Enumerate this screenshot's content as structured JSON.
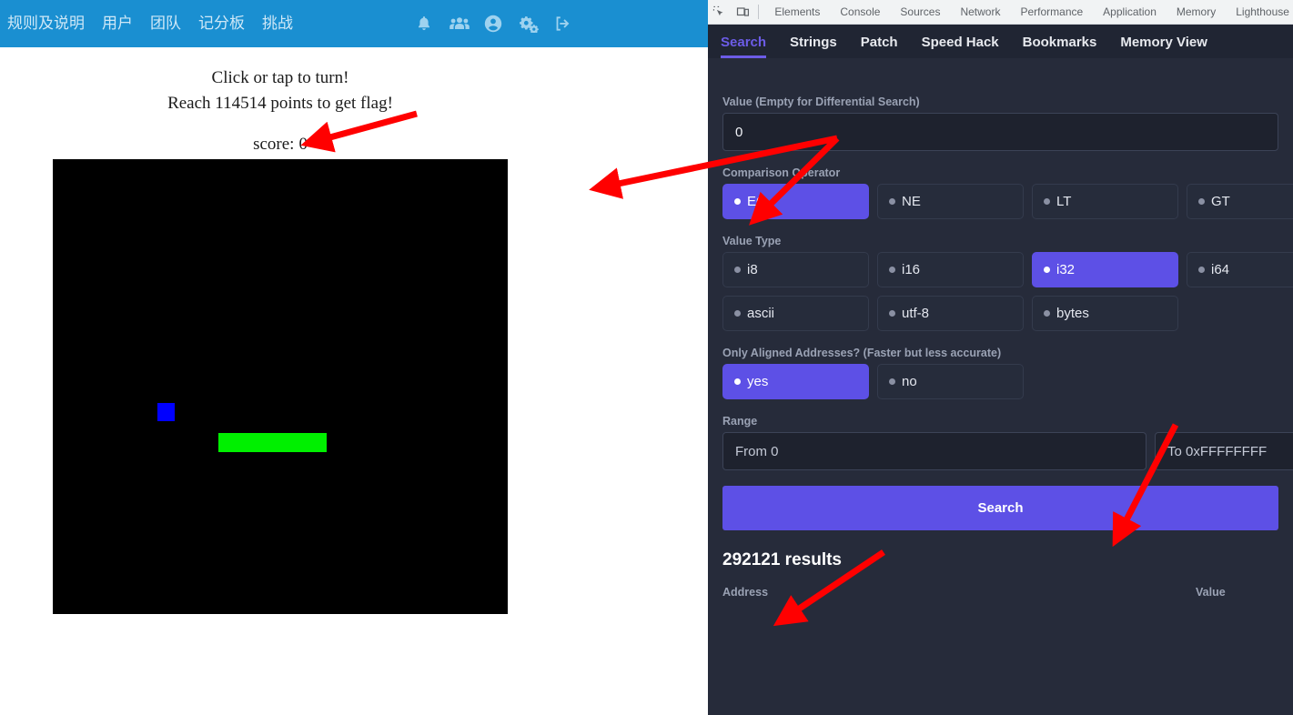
{
  "site": {
    "nav_links": [
      {
        "label": "规则及说明"
      },
      {
        "label": "用户"
      },
      {
        "label": "团队"
      },
      {
        "label": "记分板"
      },
      {
        "label": "挑战"
      }
    ],
    "nav_icons": [
      {
        "name": "bell-icon"
      },
      {
        "name": "users-icon"
      },
      {
        "name": "user-circle-icon"
      },
      {
        "name": "cogs-icon"
      },
      {
        "name": "sign-out-icon"
      }
    ],
    "navbar_color": "#1a8fd1"
  },
  "game": {
    "instruction": "Click or tap to turn!",
    "goal": "Reach 114514 points to get flag!",
    "score_label": "score:",
    "score_value": "0",
    "canvas_background": "#000000",
    "player_color": "#0000ff",
    "platform_color": "#00f000"
  },
  "devtools": {
    "toolbar_icons": [
      {
        "name": "inspect-element-icon"
      },
      {
        "name": "device-toolbar-icon"
      }
    ],
    "tabs": [
      {
        "label": "Elements"
      },
      {
        "label": "Console"
      },
      {
        "label": "Sources"
      },
      {
        "label": "Network"
      },
      {
        "label": "Performance"
      },
      {
        "label": "Application"
      },
      {
        "label": "Memory"
      },
      {
        "label": "Lighthouse"
      }
    ],
    "panel_tabs": [
      {
        "label": "Search",
        "active": true
      },
      {
        "label": "Strings",
        "active": false
      },
      {
        "label": "Patch",
        "active": false
      },
      {
        "label": "Speed Hack",
        "active": false
      },
      {
        "label": "Bookmarks",
        "active": false
      },
      {
        "label": "Memory View",
        "active": false
      }
    ],
    "accent_color": "#5d50e6",
    "search": {
      "value_label": "Value (Empty for Differential Search)",
      "value_input": "0",
      "comparison_label": "Comparison Operator",
      "comparison_options": [
        {
          "label": "EQ",
          "selected": true
        },
        {
          "label": "NE",
          "selected": false
        },
        {
          "label": "LT",
          "selected": false
        },
        {
          "label": "GT",
          "selected": false
        }
      ],
      "value_type_label": "Value Type",
      "value_type_options": [
        {
          "label": "i8",
          "selected": false
        },
        {
          "label": "i16",
          "selected": false
        },
        {
          "label": "i32",
          "selected": true
        },
        {
          "label": "i64",
          "selected": false
        },
        {
          "label": "ascii",
          "selected": false
        },
        {
          "label": "utf-8",
          "selected": false
        },
        {
          "label": "bytes",
          "selected": false
        }
      ],
      "aligned_label": "Only Aligned Addresses? (Faster but less accurate)",
      "aligned_options": [
        {
          "label": "yes",
          "selected": true
        },
        {
          "label": "no",
          "selected": false
        }
      ],
      "range_label": "Range",
      "range_from_placeholder": "From 0",
      "range_to_placeholder": "To 0xFFFFFFFF",
      "search_button": "Search",
      "results_count": "292121 results",
      "results_columns": {
        "address": "Address",
        "value": "Value"
      }
    }
  },
  "annotations": {
    "arrow_color": "#ff0000",
    "arrows": [
      {
        "name": "arrow-to-score"
      },
      {
        "name": "arrow-to-value-input"
      },
      {
        "name": "arrow-to-eq-option"
      },
      {
        "name": "arrow-to-search-button"
      },
      {
        "name": "arrow-to-results-count"
      }
    ]
  }
}
